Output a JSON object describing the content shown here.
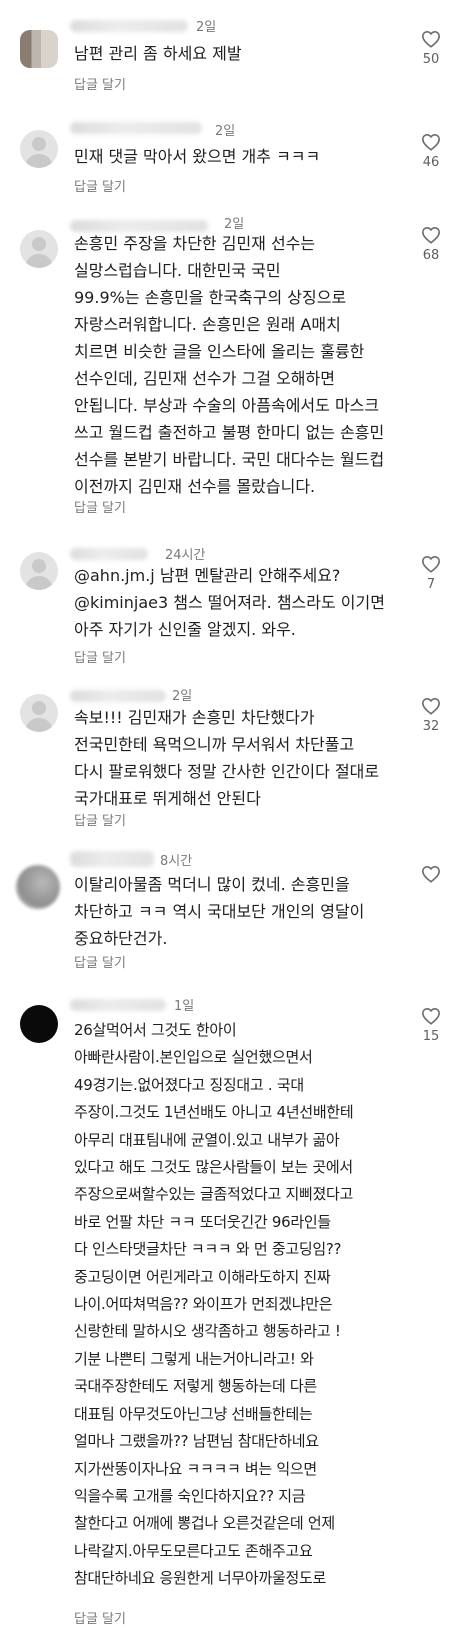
{
  "reply_label": "답글 달기",
  "icons": {
    "like": "heart-outline-icon"
  },
  "colors": {
    "text": "#1f1f1f",
    "meta": "#7a7a7a",
    "background": "#ffffff"
  },
  "comments": [
    {
      "time": "2일",
      "text": "남편 관리 좀 하세요 제발",
      "likes": "50"
    },
    {
      "time": "2일",
      "text": "민재 댓글 막아서 왔으면 개추 ㅋㅋㅋ",
      "likes": "46"
    },
    {
      "time": "2일",
      "text": "손흥민 주장을 차단한 김민재 선수는\n실망스럽습니다. 대한민국 국민\n99.9%는 손흥민을 한국축구의 상징으로\n자랑스러워합니다. 손흥민은 원래 A매치\n치르면 비슷한 글을 인스타에 올리는 훌륭한\n선수인데, 김민재 선수가 그걸 오해하면\n안됩니다. 부상과 수술의 아픔속에서도 마스크\n쓰고 월드컵 출전하고 불평 한마디 없는 손흥민\n선수를 본받기 바랍니다. 국민 대다수는 월드컵\n이전까지 김민재 선수를 몰랐습니다.",
      "likes": "68"
    },
    {
      "time": "24시간",
      "text": "@ahn.jm.j 남편 멘탈관리 안해주세요?\n@kiminjae3 챔스 떨어져라. 챔스라도 이기면\n아주 자기가 신인줄 알겠지. 와우.",
      "likes": "7"
    },
    {
      "time": "2일",
      "text": "속보!!! 김민재가 손흥민 차단했다가\n전국민한테 욕먹으니까 무서워서 차단풀고\n다시 팔로워했다 정말 간사한 인간이다 절대로\n국가대표로 뛰게해선 안된다",
      "likes": "32"
    },
    {
      "time": "8시간",
      "text": "이탈리아물좀 먹더니 많이 컸네. 손흥민을\n차단하고 ㅋㅋ 역시 국대보단 개인의 영달이\n중요하단건가.",
      "likes": ""
    },
    {
      "time": "1일",
      "text": "26살먹어서 그것도 한아이\n아빠란사람이.본인입으로 실언했으면서\n49경기는.없어졌다고 징징대고 . 국대\n주장이.그것도 1년선배도 아니고 4년선배한테\n아무리 대표팀내에 균열이.있고 내부가 곪아\n있다고 해도 그것도 많은사람들이 보는 곳에서\n주장으로써할수있는 글좀적었다고 지삐졌다고\n바로 언팔 차단 ㅋㅋ 또더웃긴간 96라인들\n다 인스타댓글차단 ㅋㅋㅋ 와 먼 중고딩임??\n중고딩이면 어린게라고 이해라도하지 진짜\n나이.어따쳐먹음?? 와이프가 먼죄겠냐만은\n신랑한테 말하시오 생각좀하고 행동하라고 !\n기분 나쁜티 그렇게 내는거아니라고! 와\n국대주장한테도 저렇게 행동하는데 다른\n대표팀 아무것도아닌그냥 선배들한테는\n얼마나 그랬을까?? 남편님 참대단하네요\n지가싼똥이자나요 ㅋㅋㅋㅋ 벼는 익으면\n익을수록 고개를 숙인다하지요?? 지금\n찰한다고 어깨에 뽕겁나 오른것같은데 언제\n나락갈지.아무도모른다고도 존해주고요\n참대단하네요 응원한게 너무아까울정도로",
      "likes": "15"
    }
  ]
}
